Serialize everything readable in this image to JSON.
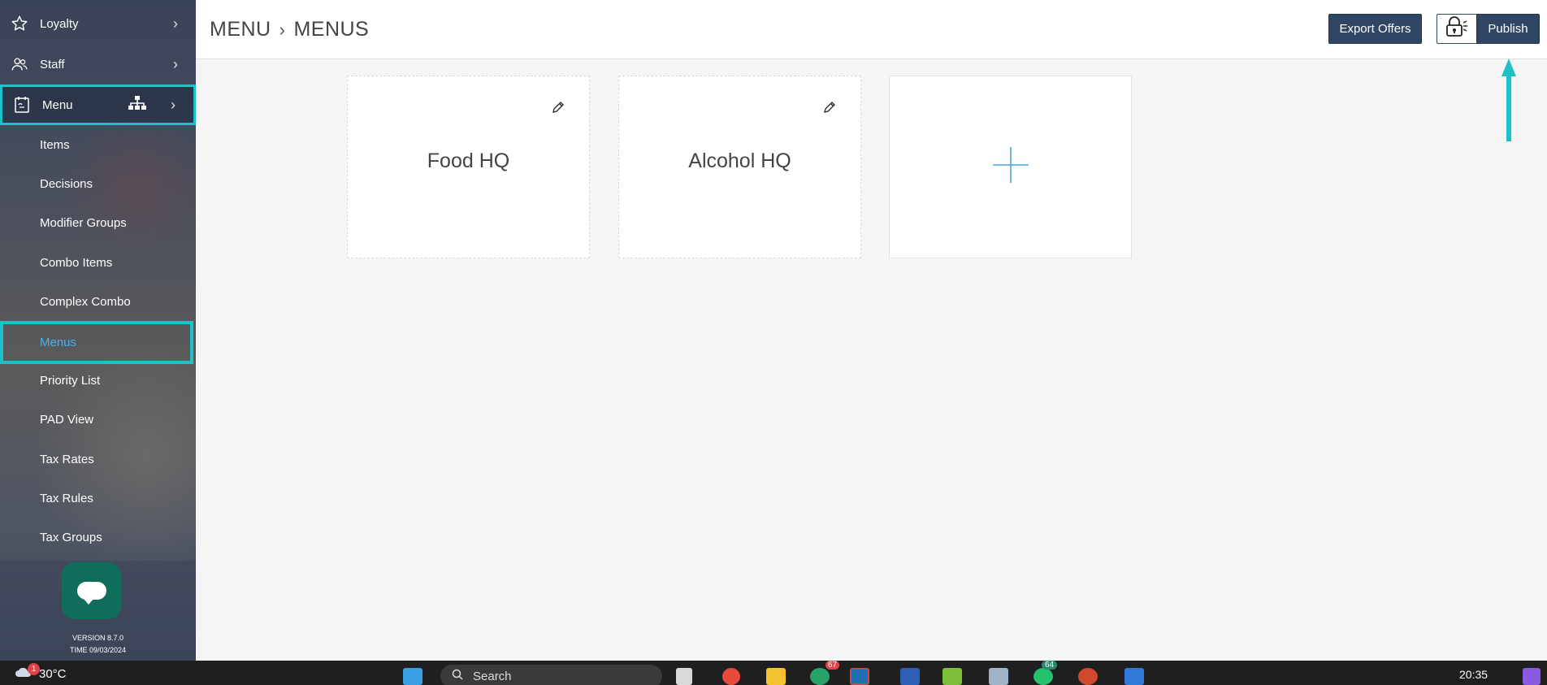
{
  "sidebar": {
    "top_items": [
      {
        "label": "Loyalty",
        "icon": "star-icon"
      },
      {
        "label": "Staff",
        "icon": "users-icon"
      },
      {
        "label": "Menu",
        "icon": "menu-book-icon"
      }
    ],
    "sub_items": [
      {
        "label": "Items"
      },
      {
        "label": "Decisions"
      },
      {
        "label": "Modifier Groups"
      },
      {
        "label": "Combo Items"
      },
      {
        "label": "Complex Combo"
      },
      {
        "label": "Menus"
      },
      {
        "label": "Priority List"
      },
      {
        "label": "PAD View"
      },
      {
        "label": "Tax Rates"
      },
      {
        "label": "Tax Rules"
      },
      {
        "label": "Tax Groups"
      }
    ],
    "active_sub": "Menus",
    "version": "VERSION 8.7.0",
    "time": "TIME 09/03/2024"
  },
  "header": {
    "crumb_parent": "MENU",
    "crumb_current": "MENUS",
    "export_label": "Export Offers",
    "publish_label": "Publish"
  },
  "cards": [
    {
      "title": "Food HQ"
    },
    {
      "title": "Alcohol HQ"
    }
  ],
  "taskbar": {
    "temperature": "30°C",
    "weather_badge": "1",
    "search_placeholder": "Search",
    "badge_slack": "67",
    "badge_whatsapp": "64",
    "clock": "20:35"
  },
  "colors": {
    "accent_highlight": "#1ec1c8",
    "button_navy": "#2f4664",
    "active_link": "#46b2f0",
    "plus_blue": "#4aa3e6"
  }
}
